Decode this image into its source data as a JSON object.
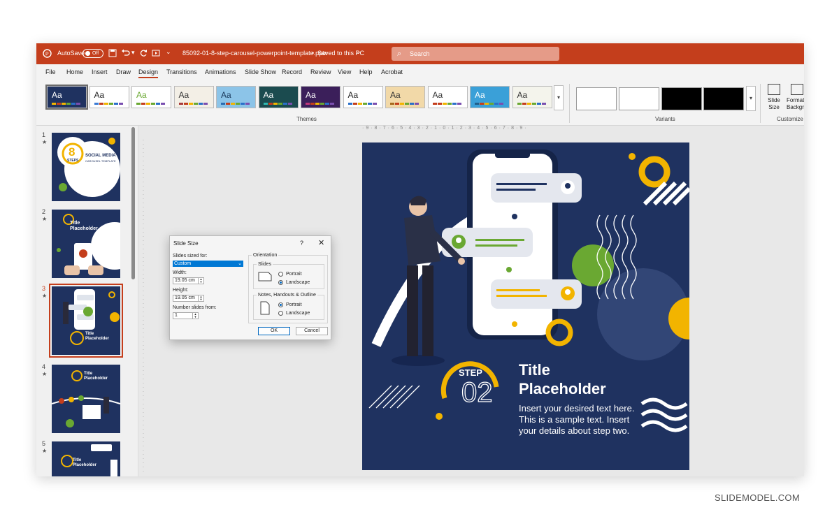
{
  "titlebar": {
    "autosave_label": "AutoSave",
    "autosave_state": "Off",
    "filename": "85092-01-8-step-carousel-powerpoint-template.pptx",
    "save_status": "Saved to this PC",
    "search_placeholder": "Search"
  },
  "menu": [
    "File",
    "Home",
    "Insert",
    "Draw",
    "Design",
    "Transitions",
    "Animations",
    "Slide Show",
    "Record",
    "Review",
    "View",
    "Help",
    "Acrobat"
  ],
  "menu_active": "Design",
  "ribbon": {
    "themes_label": "Themes",
    "variants_label": "Variants",
    "customize_label": "Customize",
    "theme_sample_text": "Aa",
    "slide_size_label": "Slide Size",
    "format_bg_label": "Format Background"
  },
  "themes": [
    {
      "bg": "#1f3260",
      "fg": "#ffffff",
      "accent": "#f2b400"
    },
    {
      "bg": "#ffffff",
      "fg": "#222222",
      "accent": "#3a7bd5"
    },
    {
      "bg": "#ffffff",
      "fg": "#6aa832",
      "accent": "#6aa832"
    },
    {
      "bg": "#f3efe6",
      "fg": "#333333",
      "accent": "#a83b3b"
    },
    {
      "bg": "#8cc4e8",
      "fg": "#1a3a5c",
      "accent": "#2b6cb0"
    },
    {
      "bg": "#1b4b4f",
      "fg": "#ffffff",
      "accent": "#2fb8b0"
    },
    {
      "bg": "#3b1f5a",
      "fg": "#ffffff",
      "accent": "#c0357a"
    },
    {
      "bg": "#ffffff",
      "fg": "#222222",
      "accent": "#2a70c9"
    },
    {
      "bg": "#f2d9a8",
      "fg": "#333333",
      "accent": "#a66a1e"
    },
    {
      "bg": "#ffffff",
      "fg": "#333333",
      "accent": "#c43e1c"
    },
    {
      "bg": "#3aa0d8",
      "fg": "#ffffff",
      "accent": "#1f5f8b"
    },
    {
      "bg": "#f4f4ec",
      "fg": "#333333",
      "accent": "#6aa832"
    }
  ],
  "thumbnails": [
    {
      "num": "1",
      "title": "SOCIAL MEDIA",
      "subtitle": "CAROUSEL TEMPLATE",
      "big": "8",
      "big_sub": "STEPS"
    },
    {
      "num": "2",
      "title": "Title Placeholder"
    },
    {
      "num": "3",
      "title": "Title Placeholder"
    },
    {
      "num": "4",
      "title": "Title Placeholder"
    },
    {
      "num": "5",
      "title": "Title Placeholder"
    }
  ],
  "current_slide": "3",
  "slide": {
    "step_label": "STEP",
    "step_number": "02",
    "title_line1": "Title",
    "title_line2": "Placeholder",
    "body_line1": "Insert your desired text here.",
    "body_line2": "This is a sample text. Insert",
    "body_line3": "your details about step two.",
    "colors": {
      "navy": "#1f3260",
      "yellow": "#f2b400",
      "green": "#6aa832",
      "white": "#ffffff"
    }
  },
  "dialog": {
    "title": "Slide Size",
    "help": "?",
    "close": "✕",
    "sized_for_label": "Slides sized for:",
    "sized_for_value": "Custom",
    "width_label": "Width:",
    "width_value": "19.05 cm",
    "height_label": "Height:",
    "height_value": "19.05 cm",
    "number_from_label": "Number slides from:",
    "number_from_value": "1",
    "orientation_label": "Orientation",
    "slides_label": "Slides",
    "portrait_label": "Portrait",
    "landscape_label": "Landscape",
    "notes_label": "Notes, Handouts & Outline",
    "ok_label": "OK",
    "cancel_label": "Cancel",
    "slides_orientation": "Landscape",
    "notes_orientation": "Portrait"
  },
  "watermark": "SLIDEMODEL.COM"
}
